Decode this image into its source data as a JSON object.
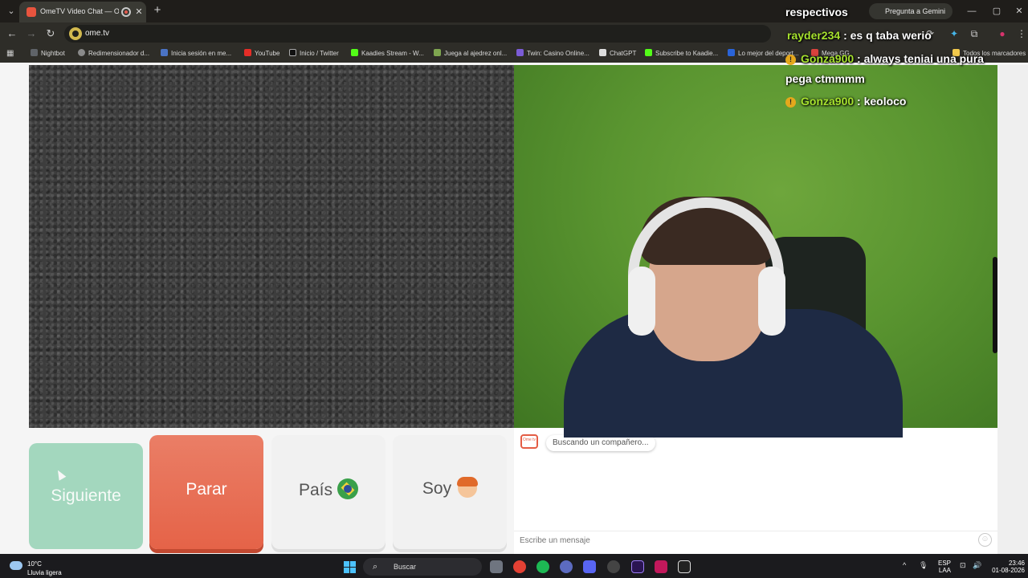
{
  "browser": {
    "tab": {
      "title": "OmeTV Video Chat — Omegle",
      "close_glyph": "✕"
    },
    "new_tab_glyph": "+",
    "tab_list_glyph": "⌄",
    "gemini_label": "Pregunta a Gemini",
    "window_controls": [
      "—",
      "▢",
      "✕"
    ],
    "url": "ome.tv",
    "nav_glyphs": {
      "back": "←",
      "forward": "→",
      "reload": "↻"
    },
    "toolbar_glyphs": [
      "⟳",
      "✦",
      "⧉",
      "●",
      "⋮"
    ],
    "bookmarks": [
      {
        "label": "Nightbot",
        "color": "#5f6368"
      },
      {
        "label": "Redimensionador d...",
        "color": "#8a8a8a"
      },
      {
        "label": "Inicia sesión en me...",
        "color": "#4a73c4"
      },
      {
        "label": "YouTube",
        "color": "#e52d27"
      },
      {
        "label": "Inicio / Twitter",
        "color": "#111111"
      },
      {
        "label": "Kaadies Stream - W...",
        "color": "#53fc18"
      },
      {
        "label": "Juega al ajedrez onl...",
        "color": "#7fa650"
      },
      {
        "label": "Twin: Casino Online...",
        "color": "#7b5cd6"
      },
      {
        "label": "ChatGPT",
        "color": "#dddddd"
      },
      {
        "label": "Subscribe to Kaadie...",
        "color": "#53fc18"
      },
      {
        "label": "Lo mejor del deport...",
        "color": "#2a64d8"
      },
      {
        "label": "Mega GG",
        "color": "#d9423d"
      },
      {
        "label": "Todos los marcadores",
        "color": "#f2c94c"
      }
    ]
  },
  "ometv": {
    "buttons": {
      "next": "Siguiente",
      "stop": "Parar",
      "country": "País",
      "gender": "Soy"
    },
    "status_message": "Buscando un compañero...",
    "bot_icon_label": "Ome tv",
    "message_placeholder": "Escribe un mensaje",
    "emoji_glyph": "☺"
  },
  "stream_overlay": {
    "top_word": "respectivos",
    "messages": [
      {
        "user": "rayder234",
        "text": ": es q taba werio",
        "badge": false
      },
      {
        "user": "Gonza900",
        "text": ": always teniai una pura",
        "text_cont": "pega ctmmmm",
        "badge": true
      },
      {
        "user": "Gonza900",
        "text": ": keoloco",
        "badge": true
      }
    ],
    "badge_glyph": "!"
  },
  "taskbar": {
    "weather_temp": "10°C",
    "weather_desc": "Lluvia ligera",
    "search_label": "Buscar",
    "search_glyph": "⌕",
    "tray_glyphs": [
      "^",
      "🎙",
      "⊡",
      "🔊"
    ],
    "language": "ESP",
    "language_sub": "LAA",
    "time": "23:46",
    "date": "01-08-2026",
    "apps": [
      {
        "name": "chrome",
        "color": "#e44134"
      },
      {
        "name": "spotify",
        "color": "#1db954"
      },
      {
        "name": "app-grey",
        "color": "#5c6bc0"
      },
      {
        "name": "discord",
        "color": "#5865f2"
      },
      {
        "name": "obs",
        "color": "#444444"
      },
      {
        "name": "premiere",
        "color": "#2a1552"
      },
      {
        "name": "aegisub",
        "color": "#c2185b"
      },
      {
        "name": "capcut",
        "color": "#222222"
      }
    ]
  }
}
